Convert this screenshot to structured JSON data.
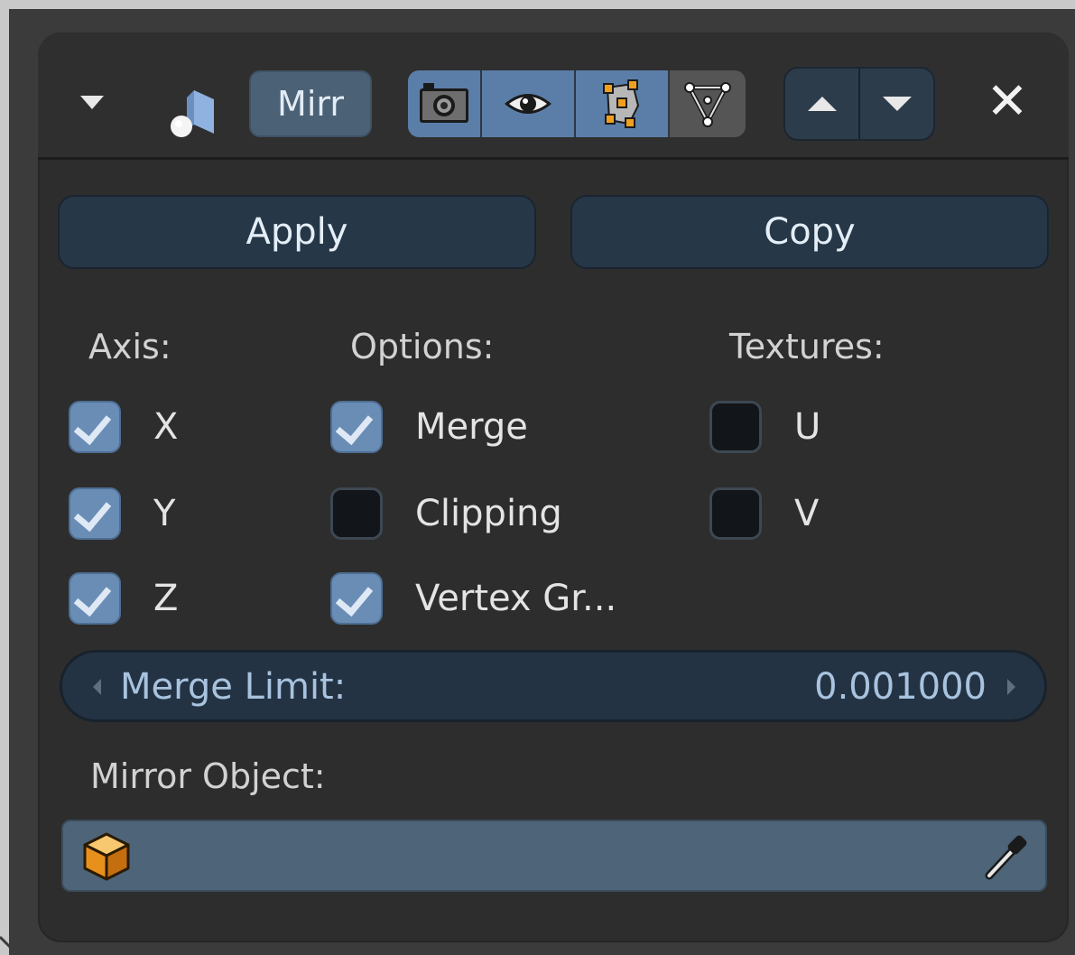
{
  "modifier_panel": {
    "name": "Mirr",
    "visibility": {
      "render": "on",
      "viewport": "on",
      "edit_mode": "on",
      "cage": "off"
    },
    "icons": {
      "collapse": "chevron-down-icon",
      "modifier_type": "mirror-modifier-icon",
      "render": "camera-icon",
      "viewport": "eye-icon",
      "edit_mode": "edit-mode-icon",
      "cage": "cage-icon",
      "move_up": "arrow-up-icon",
      "move_down": "arrow-down-icon",
      "close": "close-icon",
      "object": "cube-icon",
      "picker": "eyedropper-icon"
    },
    "close_label": "✕"
  },
  "actions": {
    "apply_label": "Apply",
    "copy_label": "Copy"
  },
  "axis": {
    "label": "Axis:",
    "items": [
      {
        "label": "X",
        "checked": true
      },
      {
        "label": "Y",
        "checked": true
      },
      {
        "label": "Z",
        "checked": true
      }
    ]
  },
  "options": {
    "label": "Options:",
    "items": [
      {
        "label": "Merge",
        "checked": true
      },
      {
        "label": "Clipping",
        "checked": false
      },
      {
        "label": "Vertex Gr...",
        "checked": true
      }
    ]
  },
  "textures": {
    "label": "Textures:",
    "items": [
      {
        "label": "U",
        "checked": false
      },
      {
        "label": "V",
        "checked": false
      }
    ]
  },
  "merge_limit": {
    "label": "Merge Limit:",
    "value": "0.001000"
  },
  "mirror_object": {
    "label": "Mirror Object:",
    "value": ""
  },
  "colors": {
    "panel_bg": "#2d2d2d",
    "accent_blue": "#5b7ea8",
    "button_bg": "#263747",
    "field_bg": "#4d6479",
    "checkbox_checked": "#6a8db6",
    "checkbox_unchecked": "#121519"
  }
}
